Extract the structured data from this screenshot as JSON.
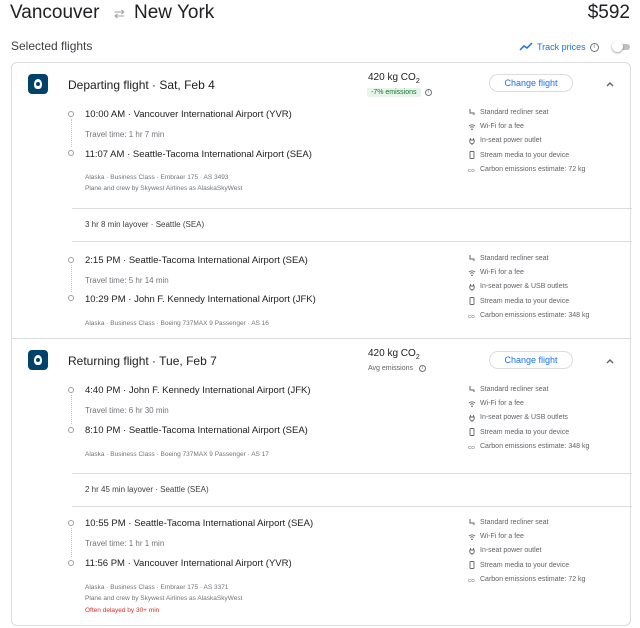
{
  "header": {
    "from": "Vancouver",
    "to": "New York",
    "price": "$592"
  },
  "selected_flights_label": "Selected flights",
  "track_prices": {
    "label": "Track prices",
    "enabled": false
  },
  "departing": {
    "title": "Departing flight",
    "date": "Sat, Feb 4",
    "emissions": "420 kg CO",
    "emissions_sub": "2",
    "emissions_note": "-7% emissions",
    "change_label": "Change flight",
    "segments": [
      {
        "depart_time": "10:00 AM",
        "depart_airport": "Vancouver International Airport (YVR)",
        "travel_time": "Travel time: 1 hr 7 min",
        "arrive_time": "11:07 AM",
        "arrive_airport": "Seattle-Tacoma International Airport (SEA)",
        "meta": "Alaska · Business Class · Embraer 175 · AS 3493",
        "meta2": "Plane and crew by Skywest Airlines as AlaskaSkyWest",
        "amenities": [
          {
            "icon": "seat-icon",
            "text": "Standard recliner seat"
          },
          {
            "icon": "wifi-icon",
            "text": "Wi-Fi for a fee"
          },
          {
            "icon": "power-icon",
            "text": "In-seat power outlet"
          },
          {
            "icon": "stream-icon",
            "text": "Stream media to your device"
          },
          {
            "icon": "co2-icon",
            "text": "Carbon emissions estimate: 72 kg"
          }
        ]
      },
      {
        "depart_time": "2:15 PM",
        "depart_airport": "Seattle-Tacoma International Airport (SEA)",
        "travel_time": "Travel time: 5 hr 14 min",
        "arrive_time": "10:29 PM",
        "arrive_airport": "John F. Kennedy International Airport (JFK)",
        "meta": "Alaska · Business Class · Boeing 737MAX 9 Passenger · AS 16",
        "amenities": [
          {
            "icon": "seat-icon",
            "text": "Standard recliner seat"
          },
          {
            "icon": "wifi-icon",
            "text": "Wi-Fi for a fee"
          },
          {
            "icon": "power-icon",
            "text": "In-seat power & USB outlets"
          },
          {
            "icon": "stream-icon",
            "text": "Stream media to your device"
          },
          {
            "icon": "co2-icon",
            "text": "Carbon emissions estimate: 348 kg"
          }
        ]
      }
    ],
    "layover": "3 hr 8 min layover · Seattle (SEA)"
  },
  "returning": {
    "title": "Returning flight",
    "date": "Tue, Feb 7",
    "emissions": "420 kg CO",
    "emissions_sub": "2",
    "emissions_note": "Avg emissions",
    "change_label": "Change flight",
    "segments": [
      {
        "depart_time": "4:40 PM",
        "depart_airport": "John F. Kennedy International Airport (JFK)",
        "travel_time": "Travel time: 6 hr 30 min",
        "arrive_time": "8:10 PM",
        "arrive_airport": "Seattle-Tacoma International Airport (SEA)",
        "meta": "Alaska · Business Class · Boeing 737MAX 9 Passenger · AS 17",
        "amenities": [
          {
            "icon": "seat-icon",
            "text": "Standard recliner seat"
          },
          {
            "icon": "wifi-icon",
            "text": "Wi-Fi for a fee"
          },
          {
            "icon": "power-icon",
            "text": "In-seat power & USB outlets"
          },
          {
            "icon": "stream-icon",
            "text": "Stream media to your device"
          },
          {
            "icon": "co2-icon",
            "text": "Carbon emissions estimate: 348 kg"
          }
        ]
      },
      {
        "depart_time": "10:55 PM",
        "depart_airport": "Seattle-Tacoma International Airport (SEA)",
        "travel_time": "Travel time: 1 hr 1 min",
        "arrive_time": "11:56 PM",
        "arrive_airport": "Vancouver International Airport (YVR)",
        "meta": "Alaska · Business Class · Embraer 175 · AS 3371",
        "meta2": "Plane and crew by Skywest Airlines as AlaskaSkyWest",
        "delayed": "Often delayed by 30+ min",
        "amenities": [
          {
            "icon": "seat-icon",
            "text": "Standard recliner seat"
          },
          {
            "icon": "wifi-icon",
            "text": "Wi-Fi for a fee"
          },
          {
            "icon": "power-icon",
            "text": "In-seat power outlet"
          },
          {
            "icon": "stream-icon",
            "text": "Stream media to your device"
          },
          {
            "icon": "co2-icon",
            "text": "Carbon emissions estimate: 72 kg"
          }
        ]
      }
    ],
    "layover": "2 hr 45 min layover · Seattle (SEA)"
  },
  "colors": {
    "accent": "#1a73e8",
    "green_badge": "#137333",
    "delay_red": "#d93025",
    "airline_navy": "#01426a"
  }
}
